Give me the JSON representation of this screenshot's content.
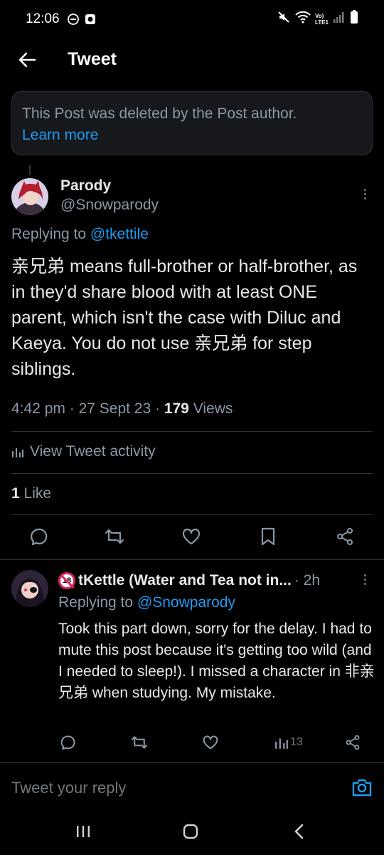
{
  "status_bar": {
    "time": "12:06",
    "left_icons": [
      "do-not-disturb-icon",
      "app-notification-icon"
    ],
    "right_icons": [
      "mute-icon",
      "wifi-icon",
      "volte-icon",
      "signal-icon",
      "battery-icon"
    ],
    "volte_label": "Vo)\nLTE1"
  },
  "header": {
    "title": "Tweet",
    "back_icon": "arrow-left-icon"
  },
  "deleted_notice": {
    "text": "This Post was deleted by the Post author.",
    "link": "Learn more"
  },
  "tweet": {
    "author_name": "Parody",
    "author_handle": "@Snowparody",
    "replying_prefix": "Replying to ",
    "replying_to": "@tkettile",
    "body": "亲兄弟 means full-brother or half-brother, as in they'd share blood with at least ONE parent, which isn't the case with Diluc and Kaeya. You do not use 亲兄弟 for step siblings.",
    "time": "4:42 pm",
    "date": "27 Sept 23",
    "views_count": "179",
    "views_label": "Views",
    "activity_label": "View Tweet activity",
    "like_count": "1",
    "like_label": "Like",
    "actions": [
      "reply-icon",
      "retweet-icon",
      "like-icon",
      "bookmark-icon",
      "share-icon"
    ]
  },
  "reply": {
    "badge": "18",
    "author_name": "tKettle (Water and Tea not in...",
    "time": "· 2h",
    "replying_prefix": "Replying to ",
    "replying_to": "@Snowparody",
    "body": "Took this part down, sorry for the delay. I had to mute this post because it's getting too wild (and I needed to sleep!). I missed a character in 非亲兄弟 when studying. My mistake.",
    "views": "13",
    "actions": [
      "reply-icon",
      "retweet-icon",
      "like-icon",
      "views-icon",
      "share-icon"
    ]
  },
  "composer": {
    "placeholder": "Tweet your reply",
    "camera_icon": "camera-icon"
  },
  "system_nav": {
    "buttons": [
      "recents-icon",
      "home-icon",
      "back-icon"
    ]
  },
  "colors": {
    "background": "#000000",
    "text": "#e7e9ea",
    "secondary_text": "#8b98a5",
    "link": "#1d9bf0",
    "divider": "#2f3336"
  }
}
